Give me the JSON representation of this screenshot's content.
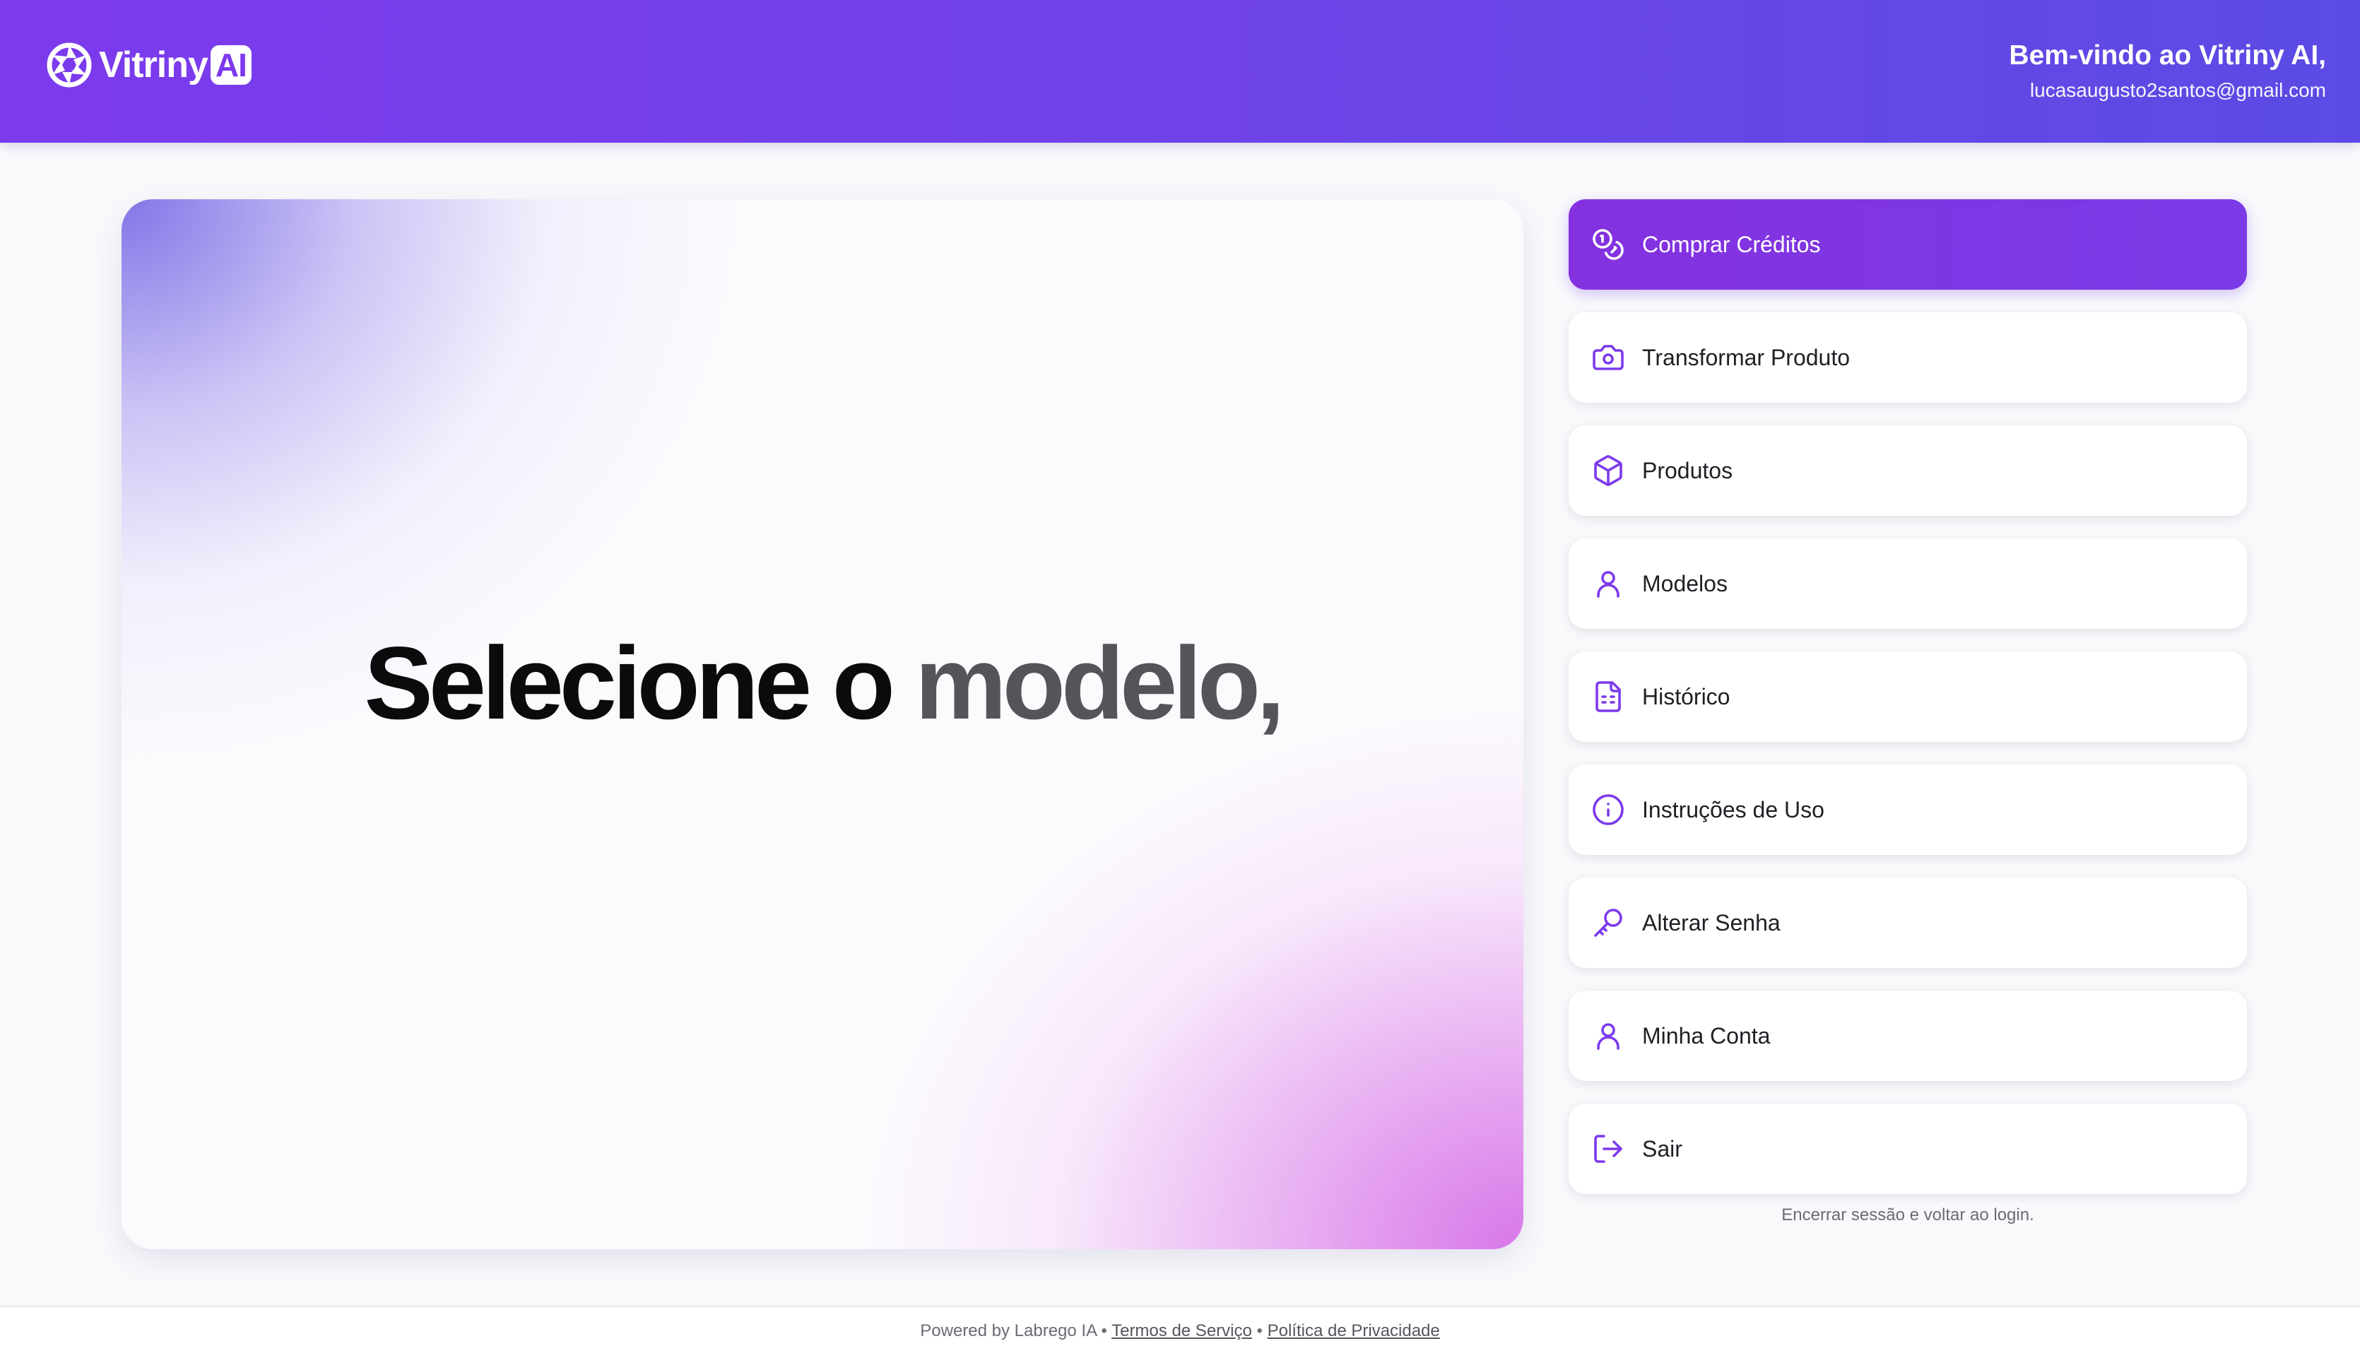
{
  "header": {
    "logo_text": "Vitriny",
    "logo_badge": "AI",
    "welcome_title": "Bem-vindo ao Vitriny AI,",
    "user_email": "lucasaugusto2santos@gmail.com"
  },
  "hero": {
    "text_part1": "Selecione o",
    "text_part2": "modelo,"
  },
  "menu": {
    "items": [
      {
        "label": "Comprar Créditos",
        "icon": "coins-icon",
        "active": true
      },
      {
        "label": "Transformar Produto",
        "icon": "camera-icon",
        "active": false
      },
      {
        "label": "Produtos",
        "icon": "box-icon",
        "active": false
      },
      {
        "label": "Modelos",
        "icon": "user-icon",
        "active": false
      },
      {
        "label": "Histórico",
        "icon": "file-list-icon",
        "active": false
      },
      {
        "label": "Instruções de Uso",
        "icon": "info-icon",
        "active": false
      },
      {
        "label": "Alterar Senha",
        "icon": "key-icon",
        "active": false
      },
      {
        "label": "Minha Conta",
        "icon": "user-icon",
        "active": false
      },
      {
        "label": "Sair",
        "icon": "logout-icon",
        "active": false
      }
    ],
    "logout_hint": "Encerrar sessão e voltar ao login."
  },
  "footer": {
    "powered_by": "Powered by Labrego IA",
    "separator": "•",
    "terms_label": "Termos de Serviço",
    "privacy_label": "Política de Privacidade"
  },
  "colors": {
    "accent": "#7c3aed",
    "header_start": "#7c3aed",
    "header_end": "#5b4be4",
    "icon_color": "#7c3aed"
  }
}
